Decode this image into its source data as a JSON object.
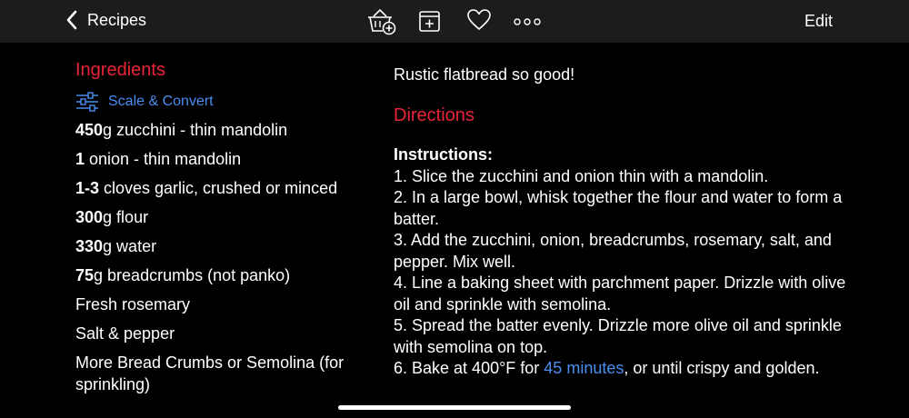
{
  "nav": {
    "back_label": "Recipes",
    "edit_label": "Edit"
  },
  "icons": [
    "basket-add-icon",
    "add-note-icon",
    "heart-icon",
    "more-icon"
  ],
  "ingredients": {
    "title": "Ingredients",
    "scale_label": "Scale & Convert",
    "items": [
      {
        "qty": "450",
        "text": "g zucchini - thin mandolin"
      },
      {
        "qty": "1",
        "text": " onion - thin mandolin"
      },
      {
        "qty": "1-3",
        "text": " cloves garlic, crushed or minced"
      },
      {
        "qty": "300",
        "text": "g flour"
      },
      {
        "qty": "330",
        "text": "g water"
      },
      {
        "qty": "75",
        "text": "g breadcrumbs (not panko)"
      },
      {
        "qty": "",
        "text": "Fresh rosemary"
      },
      {
        "qty": "",
        "text": "Salt & pepper"
      },
      {
        "qty": "",
        "text": "More Bread Crumbs or Semolina (for sprinkling)"
      }
    ]
  },
  "description": "Rustic flatbread so good!",
  "directions": {
    "title": "Directions",
    "heading": "Instructions:",
    "steps": [
      "1. Slice the zucchini and onion thin with a mandolin.",
      "2. In a large bowl, whisk together the flour and water to form a batter.",
      "3. Add the zucchini, onion, breadcrumbs, rosemary, salt, and pepper. Mix well.",
      "4. Line a baking sheet with parchment paper. Drizzle with olive oil and sprinkle with semolina.",
      "5. Spread the batter evenly. Drizzle more olive oil and sprinkle with semolina on top."
    ],
    "last_step_prefix": "6. Bake at 400°F for ",
    "timer_link": "45 minutes",
    "last_step_suffix": ", or until crispy and golden."
  },
  "colors": {
    "accent_red": "#e8243a",
    "link_blue": "#4a8df0",
    "toolbar_bg": "#1c1c1e"
  }
}
